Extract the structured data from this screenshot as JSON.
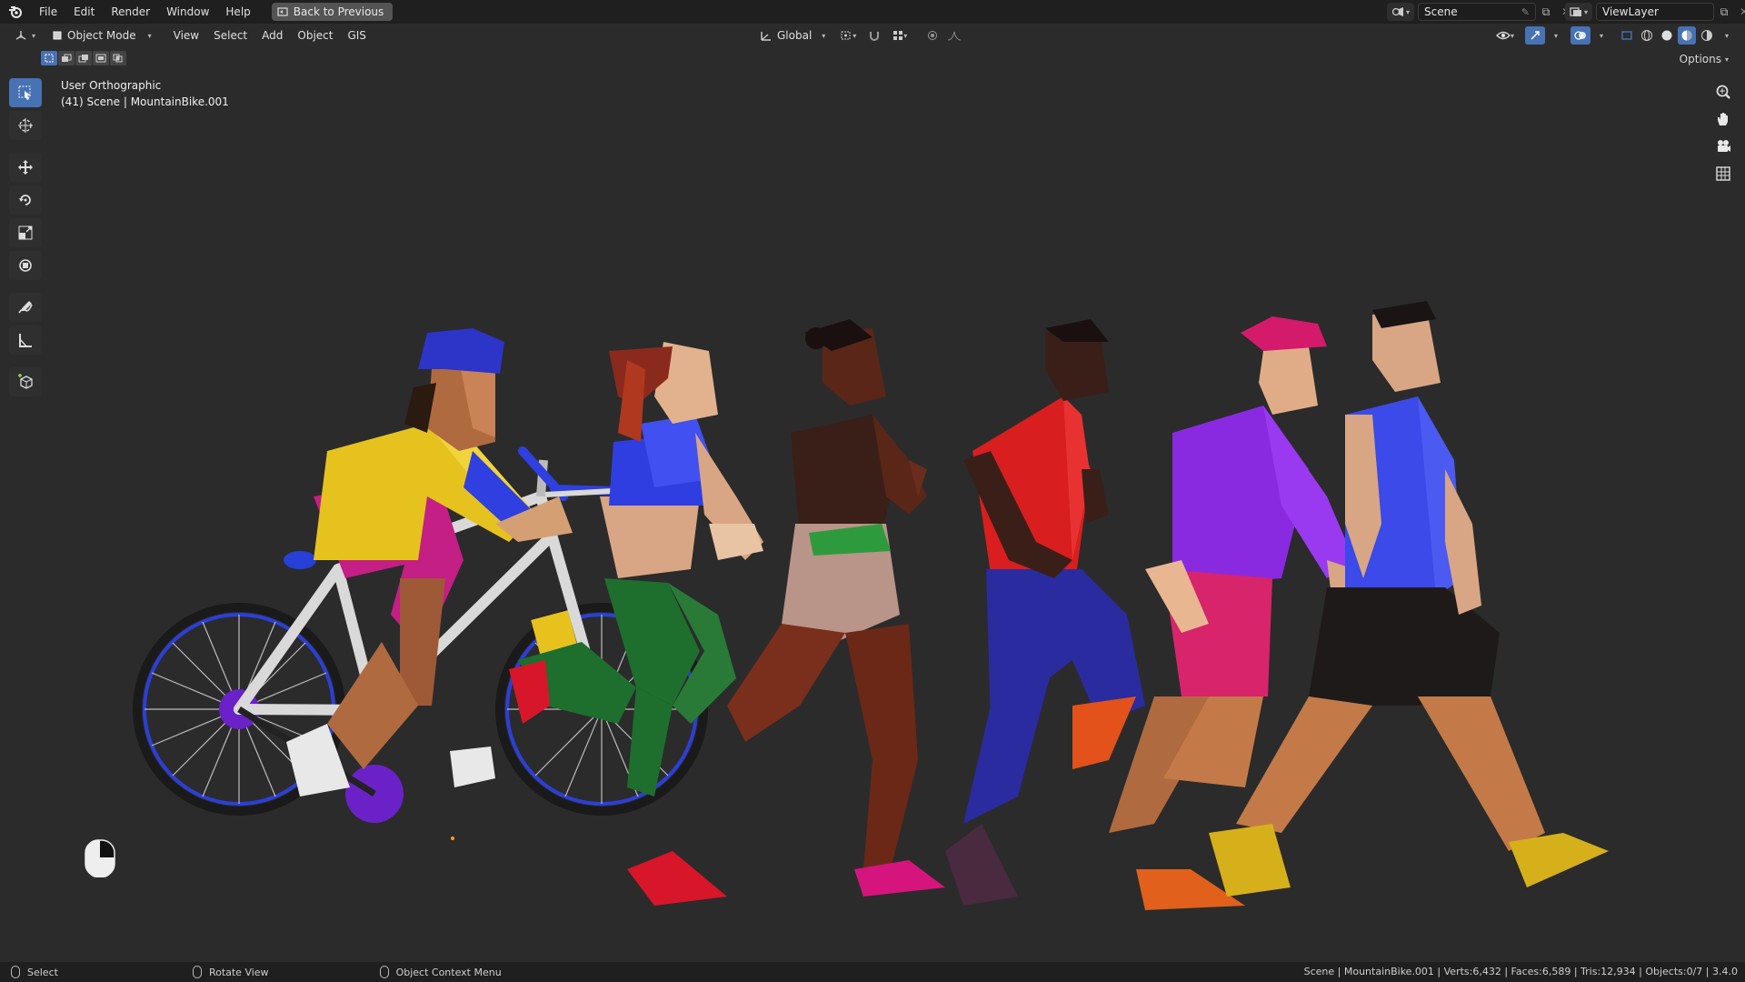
{
  "menu": {
    "items": [
      "File",
      "Edit",
      "Render",
      "Window",
      "Help"
    ],
    "back_button": "Back to Previous"
  },
  "workspace": {
    "scene_name": "Scene",
    "view_layer": "ViewLayer"
  },
  "viewport_header": {
    "mode": "Object Mode",
    "menus": [
      "View",
      "Select",
      "Add",
      "Object",
      "GIS"
    ],
    "transform_orientation": "Global",
    "options_label": "Options"
  },
  "viewport": {
    "view_name": "User Orthographic",
    "object_info": "(41) Scene | MountainBike.001"
  },
  "status_bar": {
    "hint_select": "Select",
    "hint_rotate": "Rotate View",
    "hint_context": "Object Context Menu",
    "stats": "Scene | MountainBike.001 | Verts:6,432 | Faces:6,589 | Tris:12,934 | Objects:0/7 | 3.4.0"
  },
  "colors": {
    "accent": "#4772b3",
    "background": "#2b2b2b",
    "topbar": "#1f1f1f"
  },
  "icons": [
    "blender-logo",
    "select-box-icon",
    "cursor-icon",
    "move-icon",
    "rotate-icon",
    "scale-icon",
    "transform-icon",
    "annotate-icon",
    "measure-icon",
    "add-cube-icon",
    "zoom-icon",
    "hand-pan-icon",
    "camera-icon",
    "grid-icon"
  ]
}
